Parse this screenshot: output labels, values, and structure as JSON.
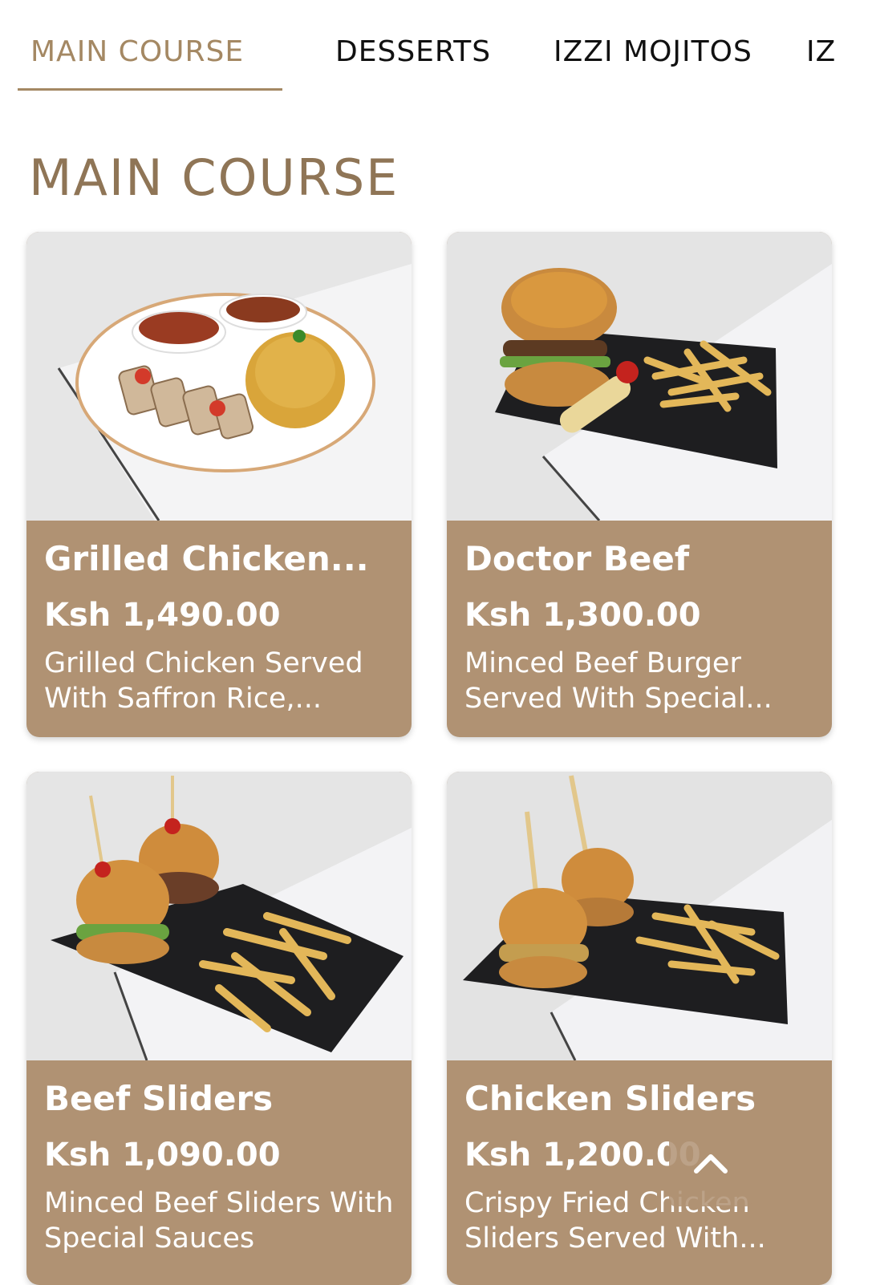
{
  "tabs": [
    {
      "label": "MAIN COURSE"
    },
    {
      "label": "DESSERTS"
    },
    {
      "label": "IZZI MOJITOS"
    },
    {
      "label": "IZ"
    }
  ],
  "section": {
    "title": "MAIN COURSE"
  },
  "items": [
    {
      "title": "Grilled Chicken...",
      "price": "Ksh 1,490.00",
      "description": "Grilled Chicken Served With Saffron Rice,..."
    },
    {
      "title": "Doctor Beef",
      "price": "Ksh 1,300.00",
      "description": "Minced Beef Burger Served With Special..."
    },
    {
      "title": "Beef Sliders",
      "price": "Ksh 1,090.00",
      "description": "Minced Beef Sliders With Special Sauces"
    },
    {
      "title": "Chicken Sliders",
      "price": "Ksh 1,200.00",
      "description": "Crispy Fried Chicken Sliders Served With..."
    }
  ],
  "colors": {
    "accent": "#a48863",
    "heading": "#8f7556",
    "card_bg": "#b09273"
  },
  "icons": {
    "back_to_top": "chevron-up-icon"
  }
}
